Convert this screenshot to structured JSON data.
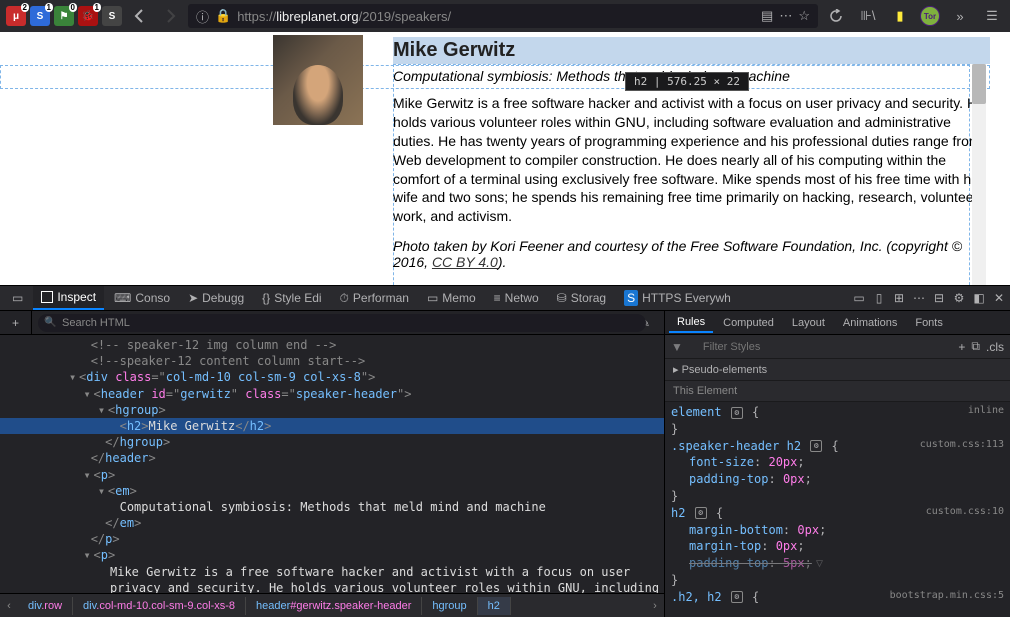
{
  "chrome": {
    "ext_badges": [
      "2",
      "1",
      "0",
      "1"
    ],
    "url_protocol": "https://",
    "url_domain": "libreplanet.org",
    "url_path": "/2019/speakers/",
    "tor_label": "Tor"
  },
  "tooltip": "h2 | 576.25 × 22",
  "speaker": {
    "name": "Mike Gerwitz",
    "subtitle": "Computational symbiosis: Methods that meld mind and machine",
    "bio": "Mike Gerwitz is a free software hacker and activist with a focus on user privacy and security. He holds various volunteer roles within GNU, including software evaluation and administrative duties. He has twenty years of programming experience and his professional duties range from Web development to compiler construction. He does nearly all of his computing within the comfort of a terminal using exclusively free software. Mike spends most of his free time with his wife and two sons; he spends his remaining free time primarily on hacking, research, volunteer work, and activism.",
    "credit_pre": "Photo taken by Kori Feener and courtesy of the Free Software Foundation, Inc. (copyright © 2016, ",
    "credit_link": "CC BY 4.0",
    "credit_post": ")."
  },
  "devtools": {
    "tabs": [
      "Inspect",
      "Conso",
      "Debugg",
      "Style Edi",
      "Performan",
      "Memo",
      "Netwo",
      "Storag",
      "HTTPS Everywh"
    ],
    "search_placeholder": "Search HTML",
    "tree": {
      "comment1": "<!-- speaker-12 img column end -->",
      "comment2": "<!--speaker-12 content column start-->",
      "div_open": [
        "<",
        "div",
        " ",
        "class",
        "=\"",
        "col-md-10 col-sm-9 col-xs-8",
        "\">"
      ],
      "header_open": [
        "<",
        "header",
        " ",
        "id",
        "=\"",
        "gerwitz",
        "\" ",
        "class",
        "=\"",
        "speaker-header",
        "\">"
      ],
      "hgroup_open": [
        "<",
        "hgroup",
        ">"
      ],
      "h2": [
        "<",
        "h2",
        ">",
        "Mike Gerwitz",
        "</",
        "h2",
        ">"
      ],
      "hgroup_close": [
        "</",
        "hgroup",
        ">"
      ],
      "header_close": [
        "</",
        "header",
        ">"
      ],
      "p_open": [
        "<",
        "p",
        ">"
      ],
      "em_open": [
        "<",
        "em",
        ">"
      ],
      "em_text": "Computational symbiosis: Methods that meld mind and machine",
      "em_close": [
        "</",
        "em",
        ">"
      ],
      "p_close": [
        "</",
        "p",
        ">"
      ],
      "p2_open": [
        "<",
        "p",
        ">"
      ],
      "p2_text": "Mike Gerwitz is a free software hacker and activist with a focus on user privacy and security. He holds various volunteer roles within GNU, including software evaluation and administrative duties. He has twenty"
    },
    "breadcrumb": [
      "div.row",
      "div.col-md-10.col-sm-9.col-xs-8",
      "header#gerwitz.speaker-header",
      "hgroup",
      "h2"
    ],
    "rules_tabs": [
      "Rules",
      "Computed",
      "Layout",
      "Animations",
      "Fonts"
    ],
    "filter_placeholder": "Filter Styles",
    "cls_label": ".cls",
    "pseudo": "Pseudo-elements",
    "this_element": "This Element",
    "rules": [
      {
        "selector": "element",
        "gear": true,
        "source": "inline",
        "props": []
      },
      {
        "selector": ".speaker-header h2",
        "gear": true,
        "source": "custom.css:113",
        "props": [
          {
            "name": "font-size",
            "value": "20px"
          },
          {
            "name": "padding-top",
            "value": "0px"
          }
        ]
      },
      {
        "selector": "h2",
        "gear": true,
        "source": "custom.css:10",
        "props": [
          {
            "name": "margin-bottom",
            "value": "0px"
          },
          {
            "name": "margin-top",
            "value": "0px"
          },
          {
            "name": "padding-top",
            "value": "5px",
            "strike": true,
            "funnel": true
          }
        ]
      },
      {
        "selector": ".h2, h2",
        "gear": true,
        "source": "bootstrap.min.css:5",
        "props": []
      }
    ]
  }
}
